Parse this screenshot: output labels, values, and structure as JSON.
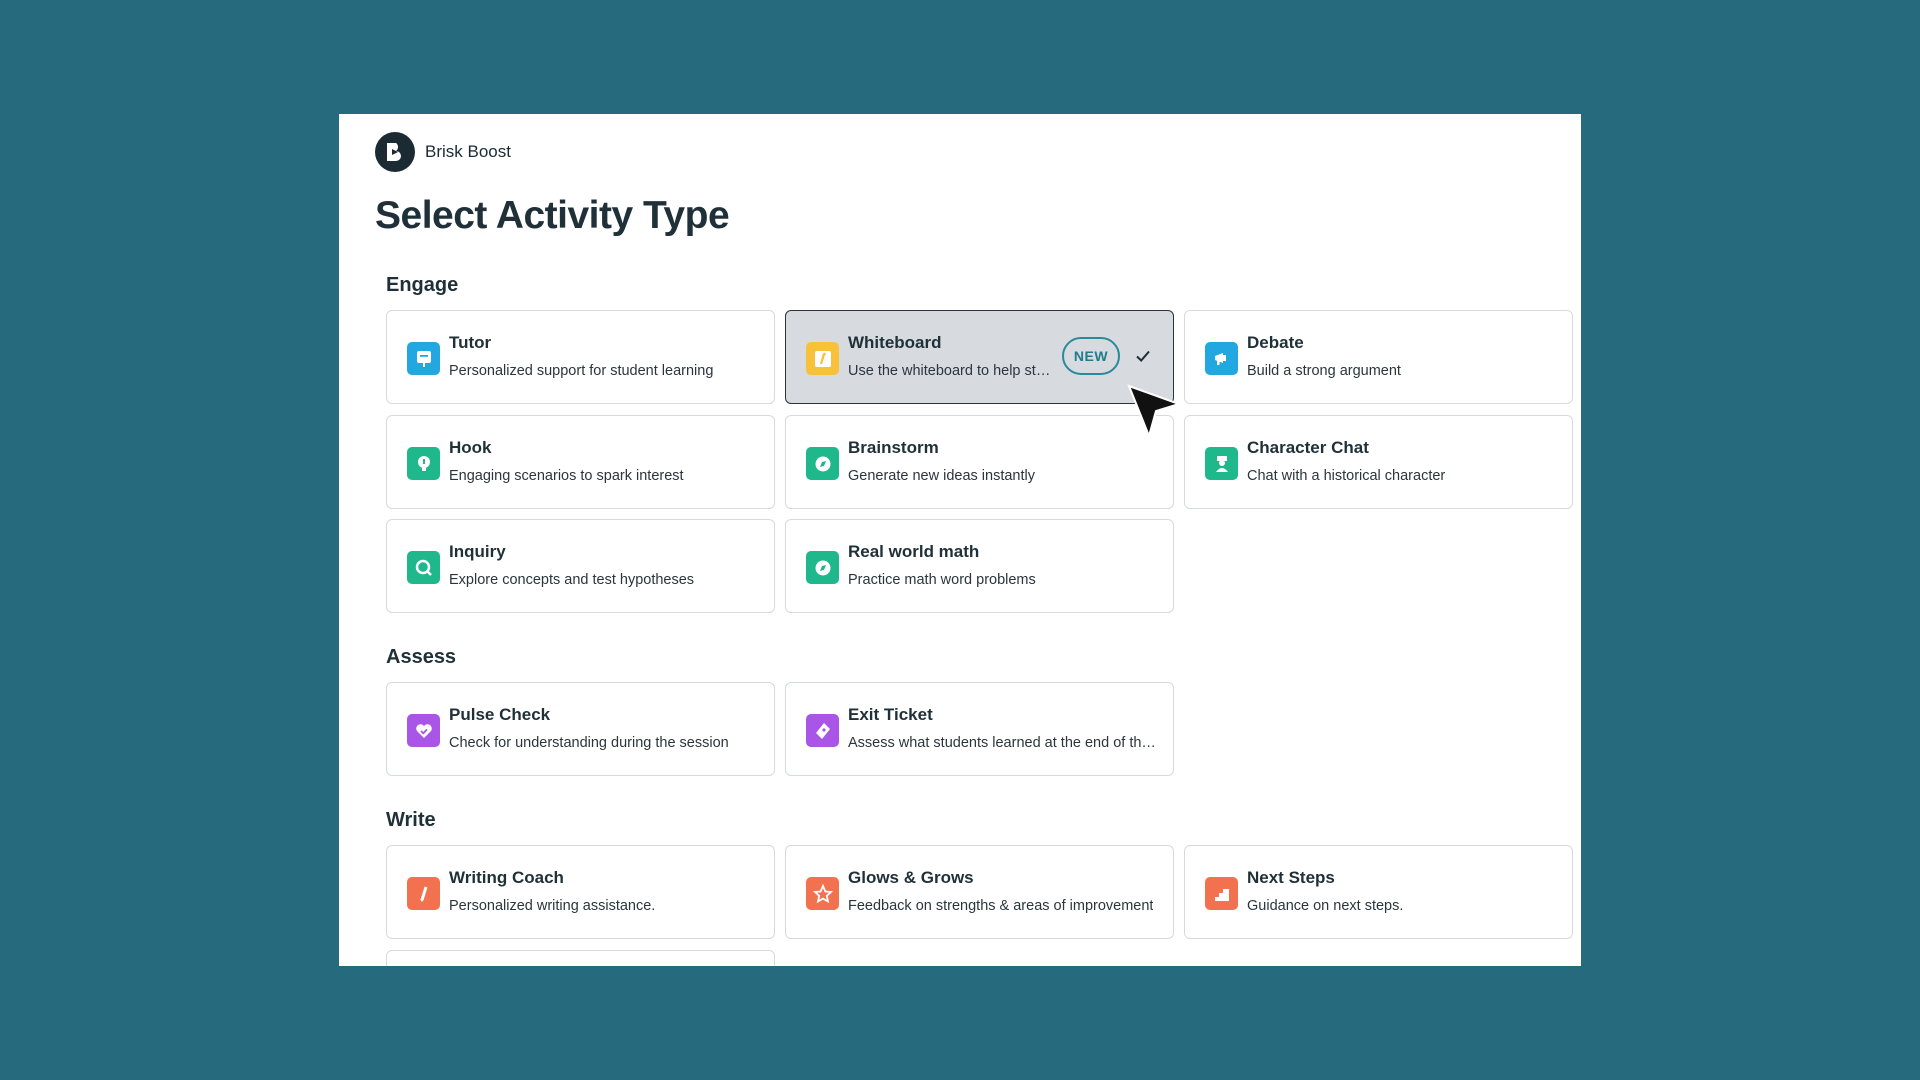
{
  "app": {
    "name": "Brisk Boost"
  },
  "page": {
    "title": "Select Activity Type"
  },
  "sections": {
    "engage": {
      "heading": "Engage",
      "cards": [
        {
          "title": "Tutor",
          "desc": "Personalized support for student learning",
          "icon": "chat-board-icon",
          "color": "#22a7e0"
        },
        {
          "title": "Whiteboard",
          "desc": "Use the whiteboard to help students",
          "icon": "whiteboard-icon",
          "color": "#f7c23a",
          "badge": "NEW",
          "selected": true
        },
        {
          "title": "Debate",
          "desc": "Build a strong argument",
          "icon": "megaphone-icon",
          "color": "#22a7e0"
        },
        {
          "title": "Hook",
          "desc": "Engaging scenarios to spark interest",
          "icon": "lightbulb-icon",
          "color": "#1fb88c"
        },
        {
          "title": "Brainstorm",
          "desc": "Generate new ideas instantly",
          "icon": "compass-icon",
          "color": "#1fb88c"
        },
        {
          "title": "Character Chat",
          "desc": "Chat with a historical character",
          "icon": "character-icon",
          "color": "#1fb88c"
        },
        {
          "title": "Inquiry",
          "desc": "Explore concepts and test hypotheses",
          "icon": "magnifier-icon",
          "color": "#1fb88c"
        },
        {
          "title": "Real world math",
          "desc": "Practice math word problems",
          "icon": "compass-icon",
          "color": "#1fb88c"
        }
      ]
    },
    "assess": {
      "heading": "Assess",
      "cards": [
        {
          "title": "Pulse Check",
          "desc": "Check for understanding during the session",
          "icon": "heart-check-icon",
          "color": "#a855e8"
        },
        {
          "title": "Exit Ticket",
          "desc": "Assess what students learned at the end of the session",
          "icon": "ticket-icon",
          "color": "#a855e8"
        }
      ]
    },
    "write": {
      "heading": "Write",
      "cards": [
        {
          "title": "Writing Coach",
          "desc": "Personalized writing assistance.",
          "icon": "pen-icon",
          "color": "#f2724f"
        },
        {
          "title": "Glows & Grows",
          "desc": "Feedback on strengths & areas of improvement",
          "icon": "star-icon",
          "color": "#f2724f"
        },
        {
          "title": "Next Steps",
          "desc": "Guidance on next steps.",
          "icon": "stairs-icon",
          "color": "#f2724f"
        }
      ]
    }
  }
}
